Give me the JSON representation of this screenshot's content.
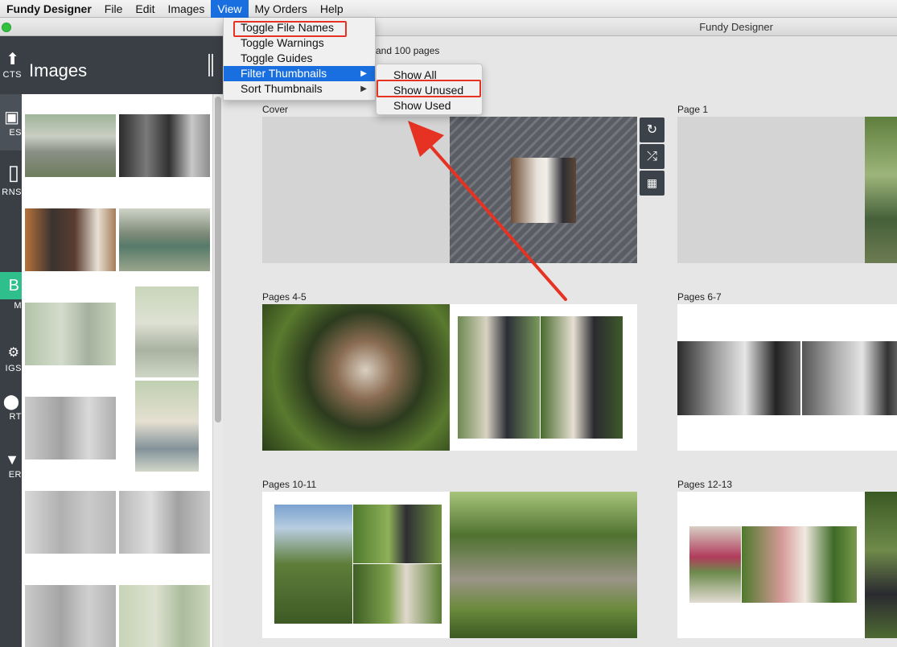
{
  "menubar": {
    "app_name": "Fundy Designer",
    "items": [
      "File",
      "Edit",
      "Images",
      "View",
      "My Orders",
      "Help"
    ]
  },
  "window": {
    "title": "Fundy Designer"
  },
  "nav": {
    "items": [
      {
        "label": "CTS",
        "icon": "up-arrow-icon"
      },
      {
        "label": "ES",
        "icon": "images-icon"
      },
      {
        "label": "RNS",
        "icon": "patterns-icon"
      },
      {
        "label": "M",
        "icon": "album-icon",
        "glyph": "B"
      },
      {
        "label": "IGS",
        "icon": "gear-icon"
      },
      {
        "label": "RT",
        "icon": "export-icon"
      },
      {
        "label": "ER",
        "icon": "order-icon"
      }
    ]
  },
  "images_panel": {
    "title": "Images"
  },
  "main": {
    "info_text": "and 100 pages",
    "spreads": [
      {
        "label": "Cover"
      },
      {
        "label": "Page 1"
      },
      {
        "label": "Pages 4-5"
      },
      {
        "label": "Pages 6-7"
      },
      {
        "label": "Pages 10-11"
      },
      {
        "label": "Pages 12-13"
      }
    ]
  },
  "view_menu": {
    "items": [
      {
        "label": "Toggle File Names"
      },
      {
        "label": "Toggle Warnings"
      },
      {
        "label": "Toggle Guides"
      },
      {
        "label": "Filter Thumbnails"
      },
      {
        "label": "Sort Thumbnails"
      }
    ],
    "filter_submenu": [
      "Show All",
      "Show Unused",
      "Show Used"
    ]
  },
  "colors": {
    "menu_highlight": "#1a6fe0",
    "annotation_red": "#e53223",
    "dark_panel": "#3a3f45",
    "album_green": "#2fbf8c"
  }
}
